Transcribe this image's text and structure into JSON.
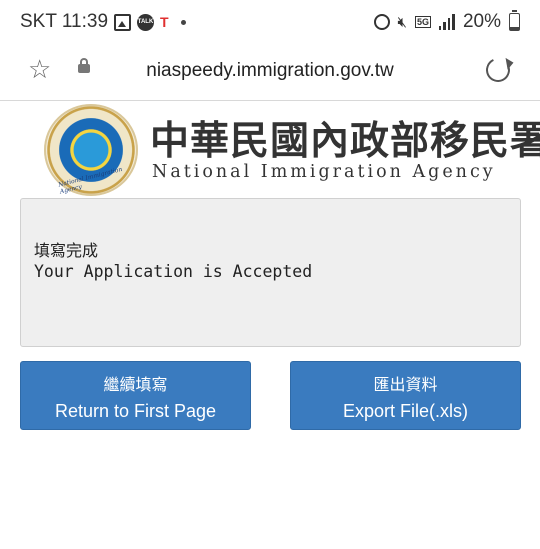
{
  "status_bar": {
    "carrier_time": "SKT 11:39",
    "network": "5G",
    "battery": "20%"
  },
  "browser": {
    "url": "niaspeedy.immigration.gov.tw"
  },
  "header": {
    "title_zh": "中華民國內政部移民署",
    "title_en": "National Immigration Agency",
    "emblem_text": "National Immigration Agency"
  },
  "message": {
    "line_zh": "填寫完成",
    "line_en": "Your Application is Accepted"
  },
  "buttons": {
    "return": {
      "zh": "繼續填寫",
      "en": "Return to First Page"
    },
    "export": {
      "zh": "匯出資料",
      "en": "Export File(.xls)"
    }
  },
  "icons": [
    "gallery-icon",
    "talk-icon",
    "notification-icon",
    "alarm-icon",
    "mute-icon",
    "signal-icon",
    "battery-icon",
    "star-icon",
    "lock-icon",
    "reload-icon"
  ],
  "colors": {
    "button": "#3a7bbf",
    "panel": "#efefef"
  }
}
